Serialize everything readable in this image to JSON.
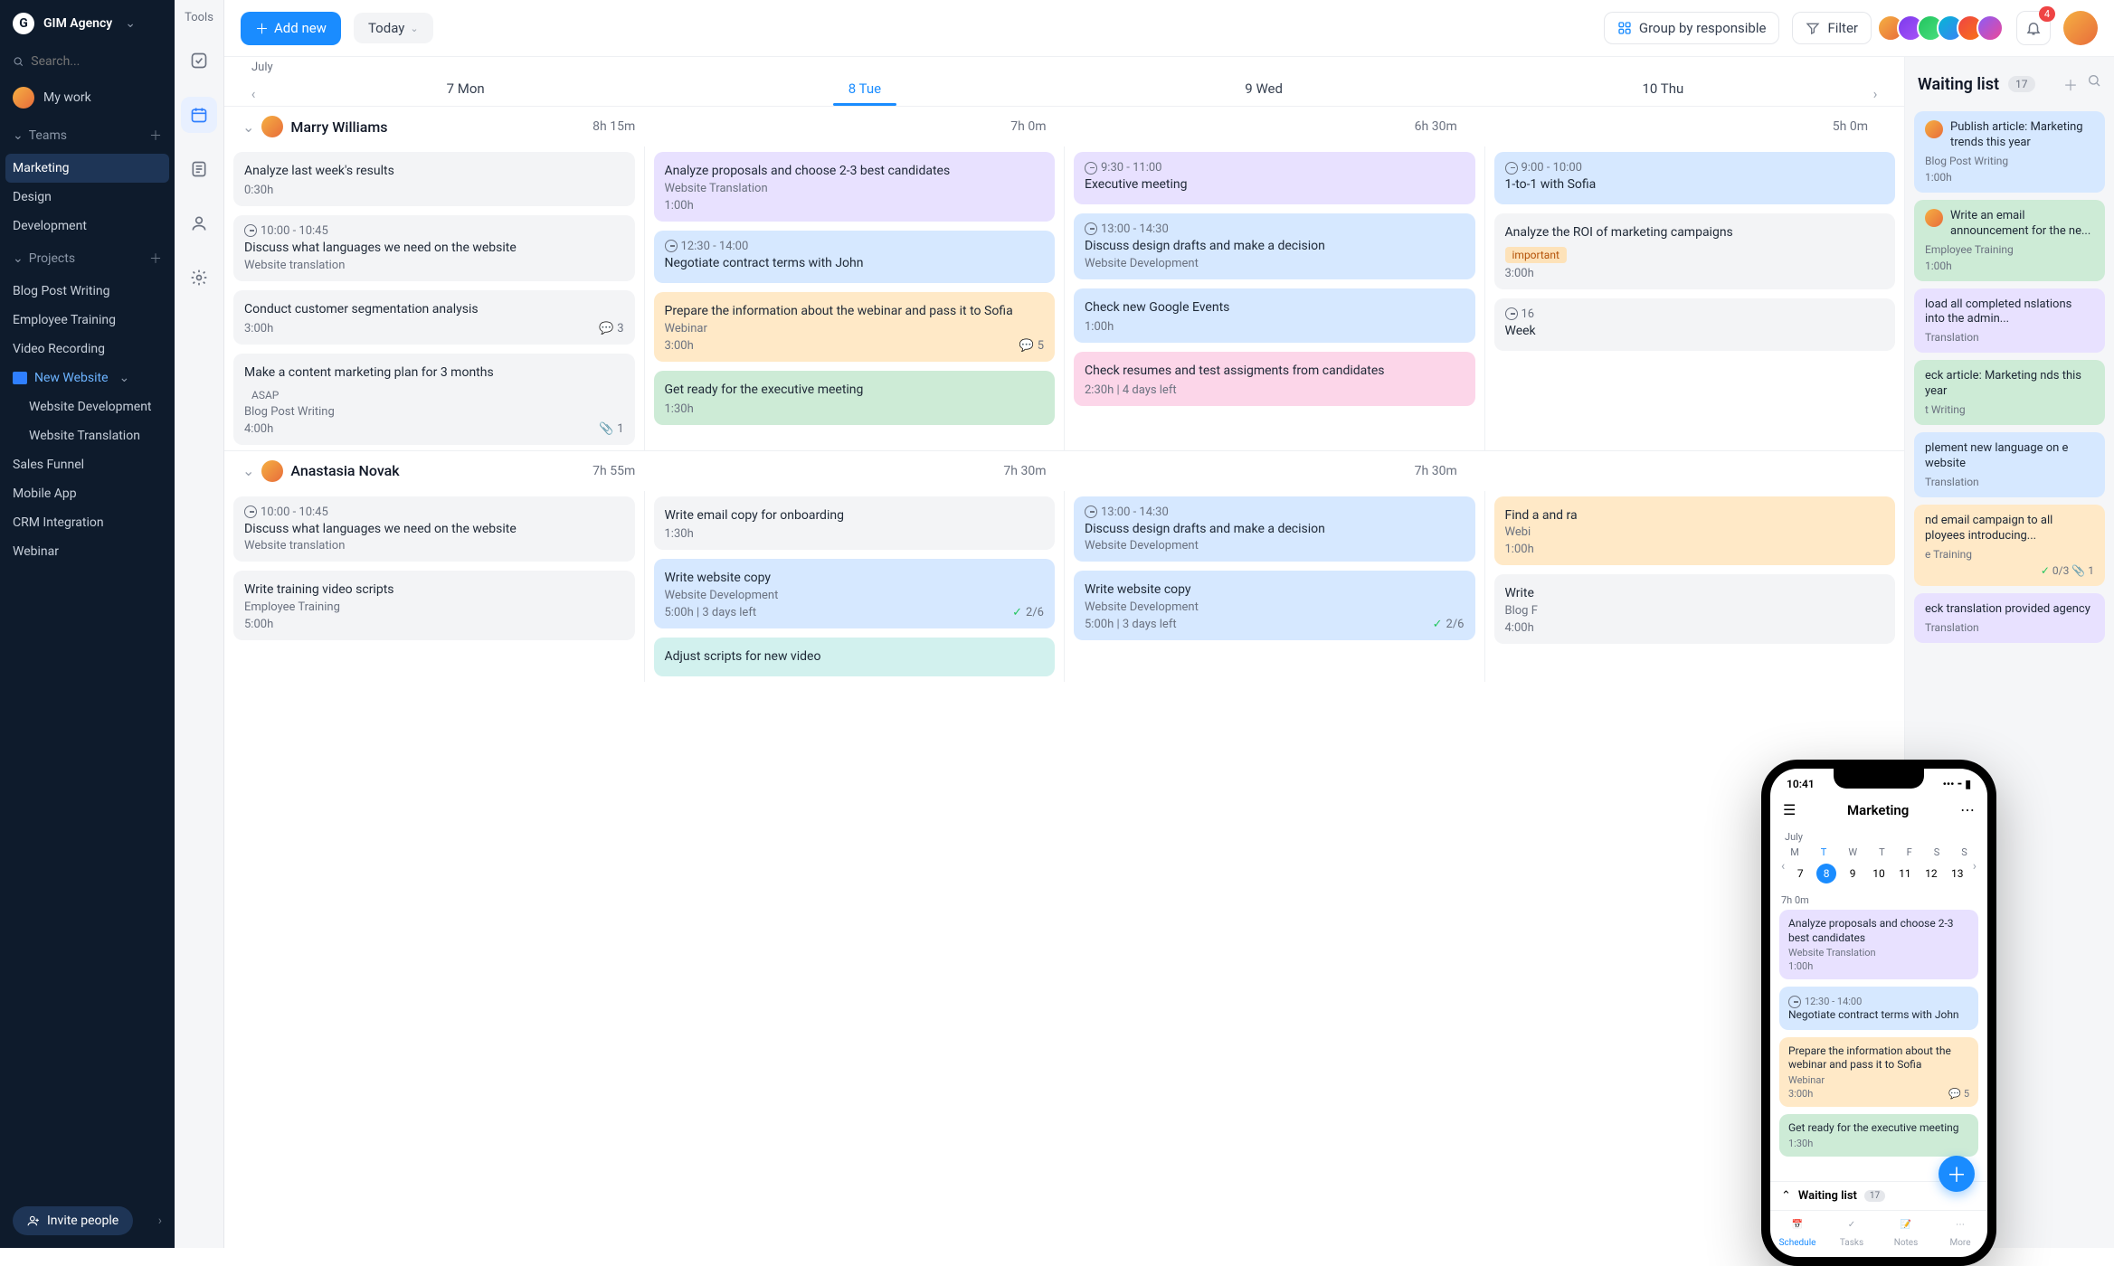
{
  "org": {
    "name": "GIM Agency"
  },
  "search": {
    "placeholder": "Search..."
  },
  "mywork": "My work",
  "teams": {
    "label": "Teams",
    "items": [
      "Marketing",
      "Design",
      "Development"
    ]
  },
  "projects": {
    "label": "Projects",
    "items": [
      "Blog Post Writing",
      "Employee Training",
      "Video Recording"
    ],
    "folder": "New Website",
    "folder_children": [
      "Website Development",
      "Website Translation"
    ],
    "rest": [
      "Sales Funnel",
      "Mobile App",
      "CRM Integration",
      "Webinar"
    ]
  },
  "invite": "Invite people",
  "tools_label": "Tools",
  "topbar": {
    "add": "Add new",
    "today": "Today",
    "group": "Group by responsible",
    "filter": "Filter",
    "notif_count": "4"
  },
  "month": "July",
  "days": [
    "7 Mon",
    "8 Tue",
    "9 Wed",
    "10 Thu"
  ],
  "people": [
    {
      "name": "Marry Williams",
      "times": [
        "8h 15m",
        "7h 0m",
        "6h 30m",
        "5h 0m"
      ],
      "cols": [
        [
          {
            "c": "c-gray",
            "title": "Analyze last week's results",
            "d": "0:30h"
          },
          {
            "c": "c-gray",
            "clock": "10:00 - 10:45",
            "title": "Discuss what languages we need on the website",
            "meta": "Website translation"
          },
          {
            "c": "c-gray",
            "title": "Conduct customer segmentation analysis",
            "d": "3:00h",
            "comments": "3"
          },
          {
            "c": "c-gray",
            "title": "Make a content marketing plan for 3 months",
            "tag": "ASAP",
            "meta": "Blog Post Writing",
            "d": "4:00h",
            "attach": "1"
          }
        ],
        [
          {
            "c": "c-purple",
            "title": "Analyze proposals and choose 2-3 best candidates",
            "meta": "Website Translation",
            "d": "1:00h"
          },
          {
            "c": "c-blue",
            "clock": "12:30 - 14:00",
            "title": "Negotiate contract terms with John"
          },
          {
            "c": "c-orange",
            "title": "Prepare the information about the webinar and pass it to Sofia",
            "meta": "Webinar",
            "d": "3:00h",
            "comments": "5"
          },
          {
            "c": "c-green",
            "title": "Get ready for the executive meeting",
            "d": "1:30h"
          }
        ],
        [
          {
            "c": "c-purple",
            "clock": "9:30 - 11:00",
            "title": "Executive meeting"
          },
          {
            "c": "c-blue",
            "clock": "13:00 - 14:30",
            "title": "Discuss design drafts and make a decision",
            "meta": "Website Development"
          },
          {
            "c": "c-blue",
            "title": "Check new Google Events",
            "d": "1:00h"
          },
          {
            "c": "c-pink",
            "title": "Check resumes and test assigments from candidates",
            "d2": "2:30h | 4 days left"
          }
        ],
        [
          {
            "c": "c-blue",
            "clock": "9:00 - 10:00",
            "title": "1-to-1 with Sofia"
          },
          {
            "c": "c-gray",
            "title": "Analyze the ROI of marketing campaigns",
            "tag_imp": "important",
            "d": "3:00h"
          },
          {
            "c": "c-gray",
            "clock": "16",
            "title": "Week"
          }
        ]
      ]
    },
    {
      "name": "Anastasia Novak",
      "times": [
        "7h 55m",
        "7h 30m",
        "7h 30m",
        ""
      ],
      "cols": [
        [
          {
            "c": "c-gray",
            "clock": "10:00 - 10:45",
            "title": "Discuss what languages we need on the website",
            "meta": "Website translation"
          },
          {
            "c": "c-gray",
            "title": "Write training video scripts",
            "meta": "Employee Training",
            "d": "5:00h"
          }
        ],
        [
          {
            "c": "c-gray",
            "title": "Write email copy for onboarding",
            "d": "1:30h"
          },
          {
            "c": "c-blue",
            "title": "Write website copy",
            "meta": "Website Development",
            "d2": "5:00h | 3 days left",
            "check": "2/6"
          },
          {
            "c": "c-teal",
            "title": "Adjust scripts for new video"
          }
        ],
        [
          {
            "c": "c-blue",
            "clock": "13:00 - 14:30",
            "title": "Discuss design drafts and make a decision",
            "meta": "Website Development"
          },
          {
            "c": "c-blue",
            "title": "Write website copy",
            "meta": "Website Development",
            "d2": "5:00h | 3 days left",
            "check": "2/6"
          }
        ],
        [
          {
            "c": "c-orange",
            "title": "Find a\nand ra",
            "meta": "Webi",
            "d": "1:00h"
          },
          {
            "c": "c-gray",
            "title": "Write",
            "meta": "Blog F",
            "d": "4:00h"
          }
        ]
      ]
    }
  ],
  "waiting": {
    "title": "Waiting list",
    "count": "17",
    "cards": [
      {
        "c": "c-blue",
        "av": true,
        "title": "Publish article: Marketing trends this year",
        "meta": "Blog Post Writing",
        "d": "1:00h"
      },
      {
        "c": "c-green",
        "av": true,
        "title": "Write an email announcement for the ne...",
        "meta": "Employee Training",
        "d": "1:00h"
      },
      {
        "c": "c-purple",
        "title": "load all completed nslations into the admin...",
        "meta": "Translation"
      },
      {
        "c": "c-green",
        "title": "eck article: Marketing nds this year",
        "meta": "t Writing"
      },
      {
        "c": "c-blue",
        "title": "plement new language on e website",
        "meta": "Translation"
      },
      {
        "c": "c-orange",
        "title": "nd email campaign to all ployees introducing...",
        "meta": "e Training",
        "check": "0/3",
        "attach": "1"
      },
      {
        "c": "c-purple",
        "title": "eck translation provided agency",
        "meta": "Translation"
      }
    ]
  },
  "phone": {
    "time": "10:41",
    "title": "Marketing",
    "month": "July",
    "wd": [
      "M",
      "T",
      "W",
      "T",
      "F",
      "S",
      "S"
    ],
    "dates": [
      "7",
      "8",
      "9",
      "10",
      "11",
      "12",
      "13"
    ],
    "daytime": "7h 0m",
    "cards": [
      {
        "c": "c-purple",
        "title": "Analyze proposals and choose 2-3 best candidates",
        "meta": "Website Translation",
        "d": "1:00h"
      },
      {
        "c": "c-blue",
        "clock": "12:30 - 14:00",
        "title": "Negotiate contract terms with John"
      },
      {
        "c": "c-orange",
        "title": "Prepare the information about the webinar and pass it to Sofia",
        "meta": "Webinar",
        "d": "3:00h",
        "comments": "5"
      },
      {
        "c": "c-green",
        "title": "Get ready for the executive meeting",
        "d": "1:30h"
      }
    ],
    "wl": "Waiting list",
    "wl_count": "17",
    "tabs": [
      "Schedule",
      "Tasks",
      "Notes",
      "More"
    ]
  }
}
